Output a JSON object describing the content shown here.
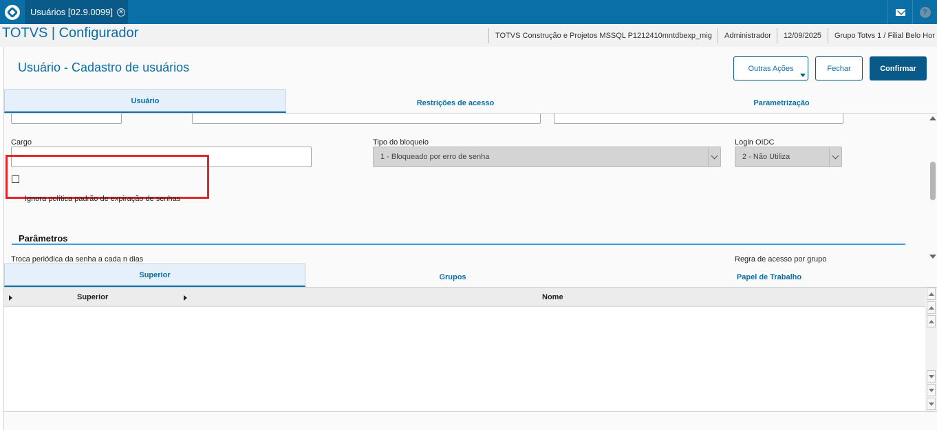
{
  "app": {
    "tab_title": "Usuários [02.9.0099]",
    "title": "TOTVS | Configurador",
    "info": {
      "environment": "TOTVS Construção e Projetos MSSQL P1212410mntdbexp_mig",
      "user": "Administrador",
      "date": "12/09/2025",
      "branch": "Grupo Totvs 1 / Filial Belo Hor"
    }
  },
  "page": {
    "title": "Usuário - Cadastro de usuários",
    "buttons": {
      "other_actions": "Outras Ações",
      "close": "Fechar",
      "confirm": "Confirmar"
    }
  },
  "main_tabs": [
    "Usuário",
    "Restrições de acesso",
    "Parametrização"
  ],
  "form": {
    "cargo_label": "Cargo",
    "cargo_value": "",
    "block_type_label": "Tipo do bloqueio",
    "block_type_value": "1 - Bloqueado por erro de senha",
    "login_oidc_label": "Login OIDC",
    "login_oidc_value": "2 - Não Utiliza",
    "ignore_policy_label": "Ignora política padrão de expiração de senhas",
    "ignore_policy_checked": false
  },
  "parameters": {
    "section_title": "Parâmetros",
    "password_change_label": "Troca periódica da senha a cada n dias",
    "access_rule_label": "Regra de acesso por grupo"
  },
  "sub_tabs": [
    "Superior",
    "Grupos",
    "Papel de Trabalho"
  ],
  "grid": {
    "columns": [
      "Superior",
      "Nome"
    ],
    "rows": []
  },
  "colors": {
    "brand": "#0a6ea7",
    "brand_dark": "#0a5a89",
    "highlight": "#e0262b"
  }
}
